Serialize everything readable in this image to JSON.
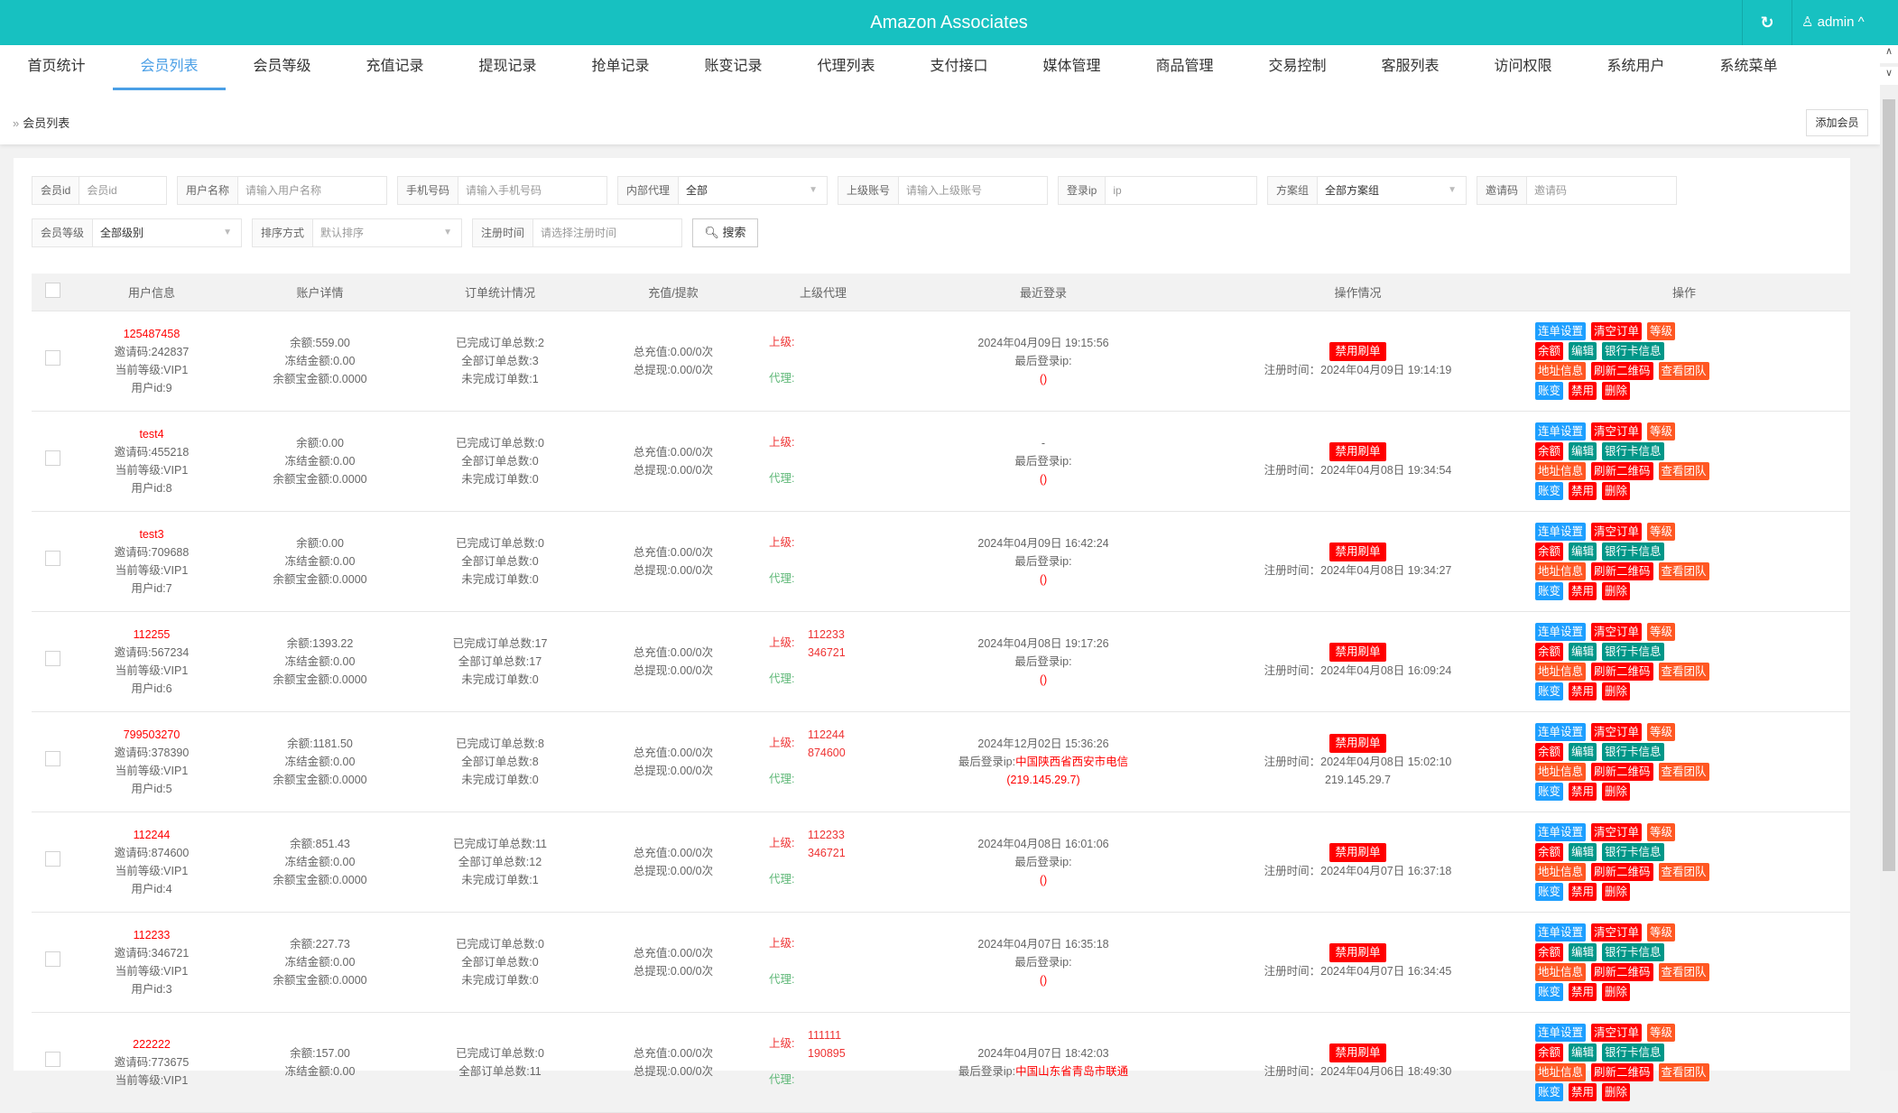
{
  "header": {
    "title": "Amazon Associates",
    "user": "admin"
  },
  "nav": {
    "tabs": [
      "首页统计",
      "会员列表",
      "会员等级",
      "充值记录",
      "提现记录",
      "抢单记录",
      "账变记录",
      "代理列表",
      "支付接口",
      "媒体管理",
      "商品管理",
      "交易控制",
      "客服列表",
      "访问权限",
      "系统用户",
      "系统菜单"
    ],
    "active": 1
  },
  "breadcrumb": "会员列表",
  "add_button": "添加会员",
  "filters": {
    "member_id": {
      "label": "会员id",
      "placeholder": "会员id"
    },
    "username": {
      "label": "用户名称",
      "placeholder": "请输入用户名称"
    },
    "phone": {
      "label": "手机号码",
      "placeholder": "请输入手机号码"
    },
    "internal_agent": {
      "label": "内部代理",
      "value": "全部"
    },
    "parent_account": {
      "label": "上级账号",
      "placeholder": "请输入上级账号"
    },
    "login_ip": {
      "label": "登录ip",
      "placeholder": "ip"
    },
    "plan_group": {
      "label": "方案组",
      "value": "全部方案组"
    },
    "invite_code": {
      "label": "邀请码",
      "placeholder": "邀请码"
    },
    "level": {
      "label": "会员等级",
      "value": "全部级别"
    },
    "sort": {
      "label": "排序方式",
      "value": "默认排序"
    },
    "reg_time": {
      "label": "注册时间",
      "placeholder": "请选择注册时间"
    },
    "search": "搜索"
  },
  "columns": [
    "用户信息",
    "账户详情",
    "订单统计情况",
    "充值/提款",
    "上级代理",
    "最近登录",
    "操作情况",
    "操作"
  ],
  "labels": {
    "parent": "上级:",
    "agent": "代理:",
    "last_ip": "最后登录ip:",
    "status_button": "禁用刷单"
  },
  "action_buttons": [
    [
      {
        "label": "连单设置",
        "color": "#1e9fff"
      },
      {
        "label": "清空订单",
        "color": "#ff0000"
      },
      {
        "label": "等级",
        "color": "#ff5722"
      }
    ],
    [
      {
        "label": "余额",
        "color": "#ff0000"
      },
      {
        "label": "编辑",
        "color": "#009688"
      },
      {
        "label": "银行卡信息",
        "color": "#009688"
      }
    ],
    [
      {
        "label": "地址信息",
        "color": "#ff5722"
      },
      {
        "label": "刷新二维码",
        "color": "#ff0000"
      },
      {
        "label": "查看团队",
        "color": "#ff5722"
      }
    ],
    [
      {
        "label": "账变",
        "color": "#1e9fff"
      },
      {
        "label": "禁用",
        "color": "#ff0000"
      },
      {
        "label": "删除",
        "color": "#ff0000"
      }
    ]
  ],
  "rows": [
    {
      "name": "125487458",
      "invite": "邀请码:242837",
      "level": "当前等级:VIP1",
      "uid": "用户id:9",
      "balance": "余额:559.00",
      "frozen": "冻结金额:0.00",
      "yeb": "余额宝金额:0.0000",
      "done": "已完成订单总数:2",
      "total": "全部订单总数:3",
      "undone": "未完成订单数:1",
      "recharge": "总充值:0.00/0次",
      "withdraw": "总提现:0.00/0次",
      "parents": [],
      "login_time": "2024年04月09日 19:15:56",
      "ip_loc": "",
      "ip": "()",
      "reg": "注册时间：2024年04月09日 19:14:19",
      "reg_ip": ""
    },
    {
      "name": "test4",
      "invite": "邀请码:455218",
      "level": "当前等级:VIP1",
      "uid": "用户id:8",
      "balance": "余额:0.00",
      "frozen": "冻结金额:0.00",
      "yeb": "余额宝金额:0.0000",
      "done": "已完成订单总数:0",
      "total": "全部订单总数:0",
      "undone": "未完成订单数:0",
      "recharge": "总充值:0.00/0次",
      "withdraw": "总提现:0.00/0次",
      "parents": [],
      "login_time": "-",
      "ip_loc": "",
      "ip": "()",
      "reg": "注册时间：2024年04月08日 19:34:54",
      "reg_ip": ""
    },
    {
      "name": "test3",
      "invite": "邀请码:709688",
      "level": "当前等级:VIP1",
      "uid": "用户id:7",
      "balance": "余额:0.00",
      "frozen": "冻结金额:0.00",
      "yeb": "余额宝金额:0.0000",
      "done": "已完成订单总数:0",
      "total": "全部订单总数:0",
      "undone": "未完成订单数:0",
      "recharge": "总充值:0.00/0次",
      "withdraw": "总提现:0.00/0次",
      "parents": [],
      "login_time": "2024年04月09日 16:42:24",
      "ip_loc": "",
      "ip": "()",
      "reg": "注册时间：2024年04月08日 19:34:27",
      "reg_ip": ""
    },
    {
      "name": "112255",
      "invite": "邀请码:567234",
      "level": "当前等级:VIP1",
      "uid": "用户id:6",
      "balance": "余额:1393.22",
      "frozen": "冻结金额:0.00",
      "yeb": "余额宝金额:0.0000",
      "done": "已完成订单总数:17",
      "total": "全部订单总数:17",
      "undone": "未完成订单数:0",
      "recharge": "总充值:0.00/0次",
      "withdraw": "总提现:0.00/0次",
      "parents": [
        "112233",
        "346721"
      ],
      "login_time": "2024年04月08日 19:17:26",
      "ip_loc": "",
      "ip": "()",
      "reg": "注册时间：2024年04月08日 16:09:24",
      "reg_ip": ""
    },
    {
      "name": "799503270",
      "invite": "邀请码:378390",
      "level": "当前等级:VIP1",
      "uid": "用户id:5",
      "balance": "余额:1181.50",
      "frozen": "冻结金额:0.00",
      "yeb": "余额宝金额:0.0000",
      "done": "已完成订单总数:8",
      "total": "全部订单总数:8",
      "undone": "未完成订单数:0",
      "recharge": "总充值:0.00/0次",
      "withdraw": "总提现:0.00/0次",
      "parents": [
        "112244",
        "874600"
      ],
      "login_time": "2024年12月02日 15:36:26",
      "ip_loc": "中国陕西省西安市电信",
      "ip": "(219.145.29.7)",
      "reg": "注册时间：2024年04月08日 15:02:10",
      "reg_ip": "219.145.29.7"
    },
    {
      "name": "112244",
      "invite": "邀请码:874600",
      "level": "当前等级:VIP1",
      "uid": "用户id:4",
      "balance": "余额:851.43",
      "frozen": "冻结金额:0.00",
      "yeb": "余额宝金额:0.0000",
      "done": "已完成订单总数:11",
      "total": "全部订单总数:12",
      "undone": "未完成订单数:1",
      "recharge": "总充值:0.00/0次",
      "withdraw": "总提现:0.00/0次",
      "parents": [
        "112233",
        "346721"
      ],
      "login_time": "2024年04月08日 16:01:06",
      "ip_loc": "",
      "ip": "()",
      "reg": "注册时间：2024年04月07日 16:37:18",
      "reg_ip": ""
    },
    {
      "name": "112233",
      "invite": "邀请码:346721",
      "level": "当前等级:VIP1",
      "uid": "用户id:3",
      "balance": "余额:227.73",
      "frozen": "冻结金额:0.00",
      "yeb": "余额宝金额:0.0000",
      "done": "已完成订单总数:0",
      "total": "全部订单总数:0",
      "undone": "未完成订单数:0",
      "recharge": "总充值:0.00/0次",
      "withdraw": "总提现:0.00/0次",
      "parents": [],
      "login_time": "2024年04月07日 16:35:18",
      "ip_loc": "",
      "ip": "()",
      "reg": "注册时间：2024年04月07日 16:34:45",
      "reg_ip": ""
    },
    {
      "name": "222222",
      "invite": "邀请码:773675",
      "level": "当前等级:VIP1",
      "balance": "余额:157.00",
      "frozen": "冻结金额:0.00",
      "done": "已完成订单总数:0",
      "total": "全部订单总数:11",
      "recharge": "总充值:0.00/0次",
      "withdraw": "总提现:0.00/0次",
      "parents": [
        "111111",
        "190895"
      ],
      "login_time": "2024年04月07日 18:42:03",
      "ip_loc": "中国山东省青岛市联通",
      "reg": "注册时间：2024年04月06日 18:49:30"
    }
  ]
}
